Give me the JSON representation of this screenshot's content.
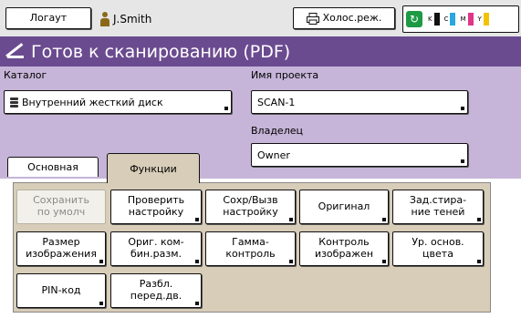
{
  "topbar": {
    "logout_label": "Логаут",
    "user_name": "J.Smith",
    "mode_label": "Холос.реж.",
    "inks": [
      {
        "label": "K",
        "color": "#111111"
      },
      {
        "label": "C",
        "color": "#29a8e0"
      },
      {
        "label": "M",
        "color": "#e0358a"
      },
      {
        "label": "Y",
        "color": "#f2c200"
      }
    ]
  },
  "title": "Готов к сканированию (PDF)",
  "settings": {
    "folder_label": "Каталог",
    "folder_value": "Внутренний жесткий диск",
    "project_label": "Имя проекта",
    "project_value": "SCAN-1",
    "owner_label": "Владелец",
    "owner_value": "Owner"
  },
  "tabs": [
    {
      "label": "Основная"
    },
    {
      "label": "Функции"
    }
  ],
  "functions": {
    "row1": [
      {
        "label": "Сохранить\nпо умолч",
        "disabled": true
      },
      {
        "label": "Проверить\nнастройку"
      },
      {
        "label": "Сохр/Вызв\nнастройку"
      },
      {
        "label": "Оригинал"
      },
      {
        "label": "Зад.стира-\nние теней"
      }
    ],
    "row2": [
      {
        "label": "Размер\nизображения"
      },
      {
        "label": "Ориг. ком-\nбин.разм."
      },
      {
        "label": "Гамма-\nконтроль"
      },
      {
        "label": "Контроль\nизображен"
      },
      {
        "label": "Ур. основ.\nцвета"
      }
    ],
    "row3": [
      {
        "label": "PIN-код"
      },
      {
        "label": "Разбл.\nперед.дв."
      }
    ]
  }
}
